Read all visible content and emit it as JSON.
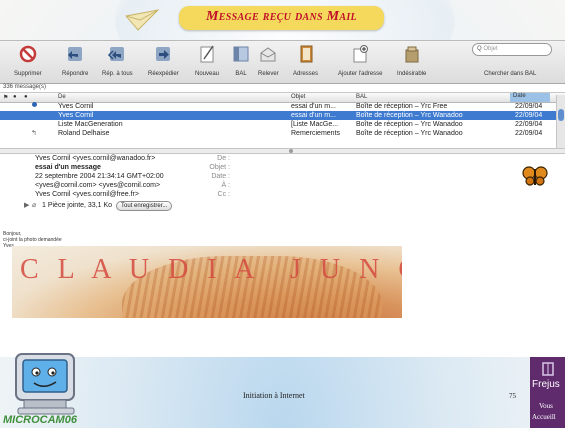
{
  "slide": {
    "title": "Message reçu dans Mail",
    "footer_text": "Initiation à Internet",
    "page_number": "75",
    "logo_left_text": "MICROCAM06",
    "logo_right_title": "Frejus",
    "logo_right_line1": "Vous",
    "logo_right_line2": "Accueill"
  },
  "toolbar": {
    "buttons": [
      {
        "label": "Supprimer",
        "icon": "delete-icon"
      },
      {
        "label": "Répondre",
        "icon": "reply-icon"
      },
      {
        "label": "Rép. à tous",
        "icon": "reply-all-icon"
      },
      {
        "label": "Réexpédier",
        "icon": "forward-icon"
      },
      {
        "label": "Nouveau",
        "icon": "compose-icon"
      },
      {
        "label": "BAL",
        "icon": "mailbox-icon"
      },
      {
        "label": "Relever",
        "icon": "get-mail-icon"
      },
      {
        "label": "Adresses",
        "icon": "address-book-icon"
      },
      {
        "label": "Ajouter l'adresse",
        "icon": "add-address-icon"
      },
      {
        "label": "Indésirable",
        "icon": "junk-icon"
      }
    ],
    "search_placeholder": "Objet",
    "search_label": "Chercher dans BAL"
  },
  "message_list": {
    "count": "336 message(s)",
    "columns": {
      "from": "De",
      "subject": "Objet",
      "mailbox": "BAL",
      "date": "Date"
    },
    "rows": [
      {
        "from": "Yves Cornil",
        "subject": "essai d'un m...",
        "mailbox": "Boîte de réception – Yrc Free",
        "date": "22/09/04",
        "selected": false,
        "status": "unread"
      },
      {
        "from": "Yves Cornil",
        "subject": "essai d'un m...",
        "mailbox": "Boîte de réception – Yrc Wanadoo",
        "date": "22/09/04",
        "selected": true,
        "status": ""
      },
      {
        "from": "Liste MacGeneration",
        "subject": "[Liste MacGe...",
        "mailbox": "Boîte de réception – Yrc Wanadoo",
        "date": "22/09/04",
        "selected": false,
        "status": ""
      },
      {
        "from": "Roland Delhaise",
        "subject": "Remerciements",
        "mailbox": "Boîte de réception – Yrc Wanadoo",
        "date": "22/09/04",
        "selected": false,
        "status": "replied"
      }
    ]
  },
  "message": {
    "headers": [
      {
        "key": "De :",
        "value": "Yves Cornil <yves.cornil@wanadoo.fr>"
      },
      {
        "key": "Objet :",
        "value": "essai d'un message"
      },
      {
        "key": "Date :",
        "value": "22 septembre 2004 21:34:14 GMT+02:00"
      },
      {
        "key": "À :",
        "value": "<yves@cornil.com> <yves@cornil.com>"
      },
      {
        "key": "Cc :",
        "value": "Yves Cornil <yves.cornil@free.fr>"
      }
    ],
    "attachment_text": "1 Pièce jointe, 33,1 Ko",
    "save_all_label": "Tout enregistrer...",
    "body_lines": [
      "Bonjour,",
      "ci-joint la photo demandée",
      "Yves"
    ],
    "photo_text_left": "C L A U D I A",
    "photo_text_right": "J U N G"
  },
  "colors": {
    "selection": "#3e7bd0",
    "title_text": "#c0102a",
    "title_banner": "#f4d95c"
  }
}
